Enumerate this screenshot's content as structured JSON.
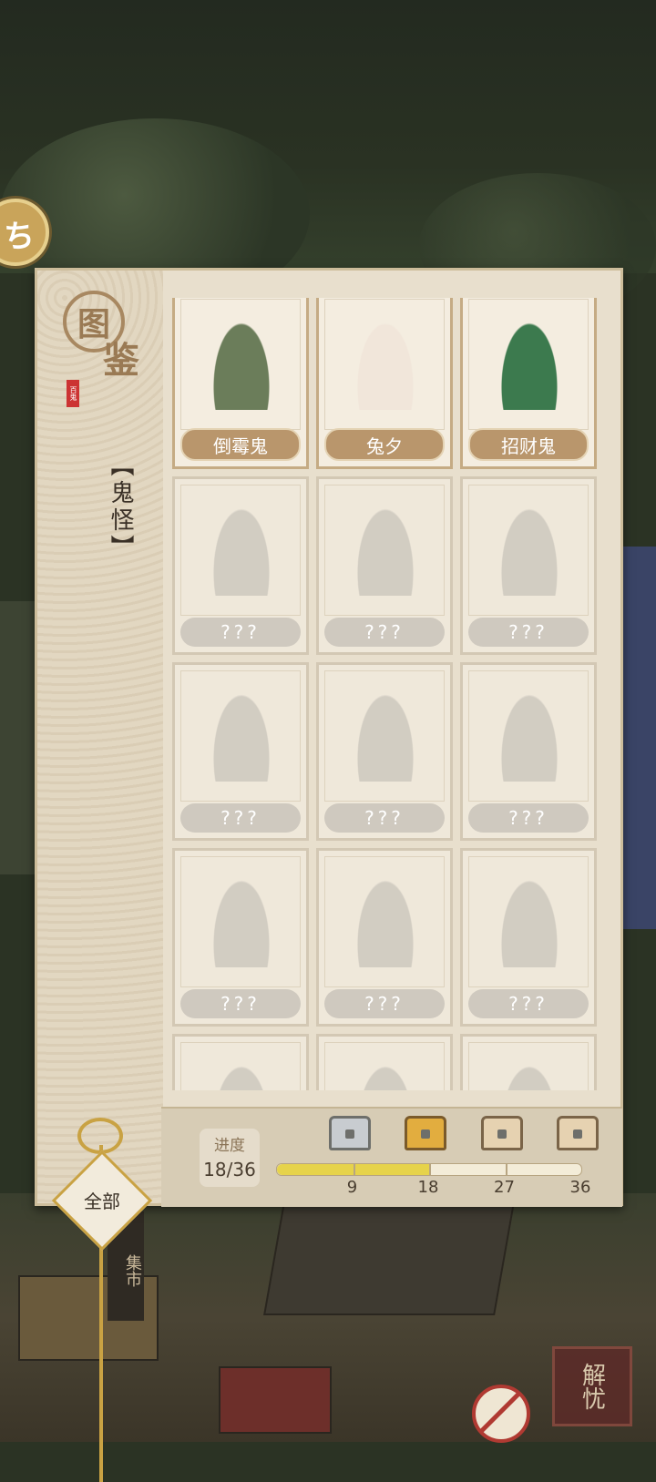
{
  "panel": {
    "title": "图鉴",
    "seal_text": "百鬼",
    "category": "【鬼怪】",
    "filter_label": "全部"
  },
  "cards": [
    {
      "name": "倒霉鬼",
      "unlocked": true
    },
    {
      "name": "兔夕",
      "unlocked": true
    },
    {
      "name": "招财鬼",
      "unlocked": true
    },
    {
      "name": "???",
      "unlocked": false
    },
    {
      "name": "???",
      "unlocked": false
    },
    {
      "name": "???",
      "unlocked": false
    },
    {
      "name": "???",
      "unlocked": false
    },
    {
      "name": "???",
      "unlocked": false
    },
    {
      "name": "???",
      "unlocked": false
    },
    {
      "name": "???",
      "unlocked": false
    },
    {
      "name": "???",
      "unlocked": false
    },
    {
      "name": "???",
      "unlocked": false
    },
    {
      "name": "",
      "unlocked": false
    },
    {
      "name": "",
      "unlocked": false
    },
    {
      "name": "",
      "unlocked": false
    }
  ],
  "progress": {
    "label": "进度",
    "count": "18/36",
    "current": 18,
    "total": 36,
    "milestones": [
      {
        "value": "9",
        "chest": "silver-chest-icon"
      },
      {
        "value": "18",
        "chest": "gold-chest-icon"
      },
      {
        "value": "27",
        "chest": "wood-chest-icon"
      },
      {
        "value": "36",
        "chest": "wood-chest-icon"
      }
    ]
  },
  "scene": {
    "market_sign": "集市",
    "jieyou_button": "解忧"
  },
  "colors": {
    "panel_bg": "#e8dfcd",
    "label_unlocked": "#b9966c",
    "progress_fill": "#e6d34b"
  }
}
